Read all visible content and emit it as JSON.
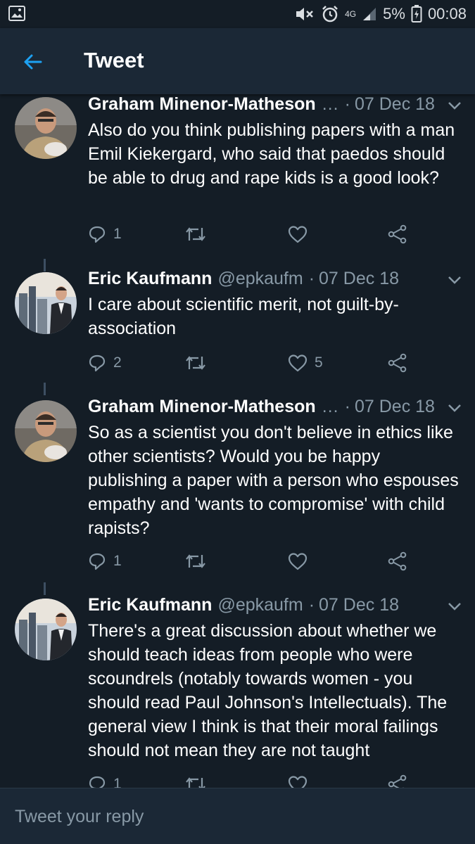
{
  "status_bar": {
    "battery": "5%",
    "network": "4G",
    "time": "00:08"
  },
  "header": {
    "title": "Tweet",
    "back_icon": "arrow-left-icon",
    "accent": "#1da1f2"
  },
  "tweets": [
    {
      "name": "Graham Minenor-Matheson",
      "handle": "",
      "truncated": "…",
      "date": "07 Dec 18",
      "text": "Also do you think publishing papers with a man Emil Kiekergard, who said that paedos should be able to drug and rape kids is a good look?",
      "replies": "1",
      "retweets": "",
      "likes": ""
    },
    {
      "name": "Eric Kaufmann",
      "handle": "@epkaufm",
      "truncated": "",
      "date": "07 Dec 18",
      "text": "I care about scientific merit, not guilt-by-association",
      "replies": "2",
      "retweets": "",
      "likes": "5"
    },
    {
      "name": "Graham Minenor-Matheson",
      "handle": "",
      "truncated": "…",
      "date": "07 Dec 18",
      "text": "So as a scientist you don't believe in ethics like other scientists? Would you be happy publishing a paper with a person who espouses empathy and 'wants to compromise' with child rapists?",
      "replies": "1",
      "retweets": "",
      "likes": ""
    },
    {
      "name": "Eric Kaufmann",
      "handle": "@epkaufm",
      "truncated": "",
      "date": "07 Dec 18",
      "text": "There's a great discussion about whether we should teach ideas from people who were scoundrels (notably towards women - you should read Paul Johnson's Intellectuals). The general view I think is that their moral failings should not mean they are not taught",
      "replies": "1",
      "retweets": "",
      "likes": ""
    }
  ],
  "reply": {
    "placeholder": "Tweet your reply"
  },
  "colors": {
    "background": "#141d26",
    "header": "#1b2836",
    "muted": "#8899a6"
  }
}
